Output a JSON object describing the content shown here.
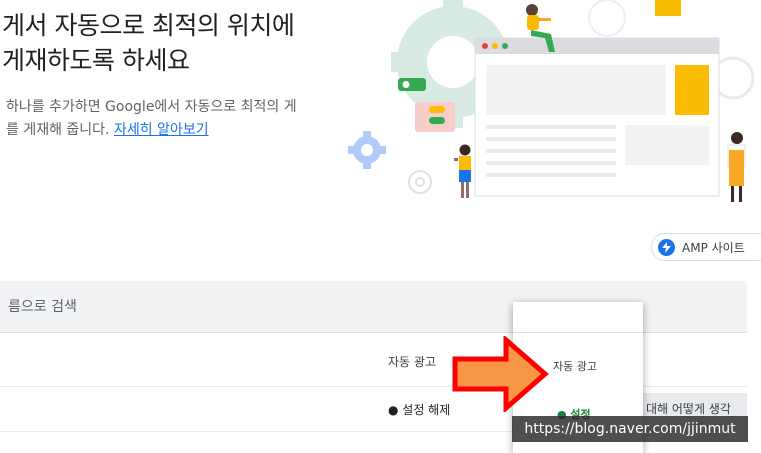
{
  "hero": {
    "title_line1": "게서 자동으로 최적의 위치에",
    "title_line2": "게재하도록 하세요",
    "desc_line1": "하나를 추가하면 Google에서 자동으로 최적의 게",
    "desc_line2": "를 게재해 줍니다.",
    "learn_more": "자세히 알아보기"
  },
  "amp_chip": {
    "label": "AMP 사이트",
    "icon": "lightning-bolt-icon"
  },
  "search": {
    "placeholder": "름으로 검색"
  },
  "table": {
    "row1": {
      "auto_ads": "자동 광고"
    },
    "row2": {
      "status": "● 설정 해제"
    },
    "partial_text": "대해 어떻게 생각"
  },
  "popup": {
    "item": "자동 광고",
    "status": "● 설정"
  },
  "watermark": "https://blog.naver.com/jjinmut",
  "colors": {
    "accent": "#1a73e8",
    "arrow_fill": "#f79646",
    "arrow_stroke": "#ff0000",
    "gear": "#d7ebe3",
    "status_on": "#188038",
    "illustration_yellow": "#fbbc04"
  }
}
